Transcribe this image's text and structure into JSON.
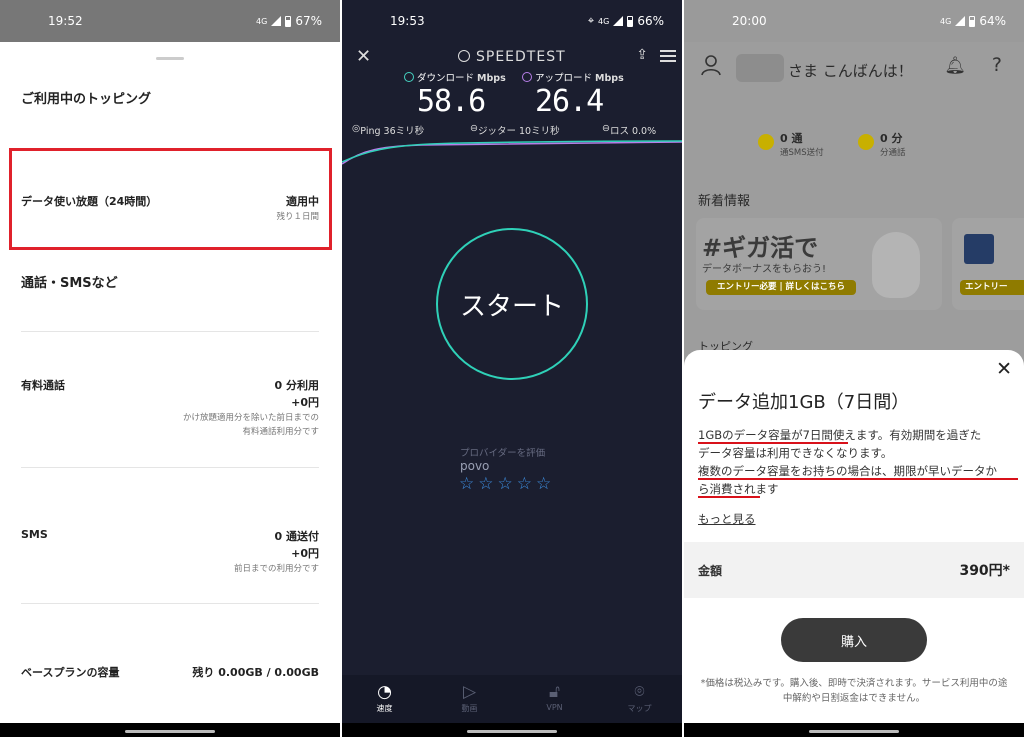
{
  "panel1": {
    "status": {
      "time": "19:52",
      "network": "4G",
      "battery": "67%"
    },
    "current_topping_header": "ご利用中のトッピング",
    "topping": {
      "name": "データ使い放題（24時間）",
      "status": "適用中",
      "remaining": "残り１日間"
    },
    "calls_header": "通話・SMSなど",
    "paid_call": {
      "label": "有料通話",
      "value": "0 分利用",
      "amount": "+0円",
      "note1": "かけ放題適用分を除いた前日までの",
      "note2": "有料通話利用分です"
    },
    "sms": {
      "label": "SMS",
      "value": "0 通送付",
      "amount": "+0円",
      "note": "前日までの利用分です"
    },
    "base_plan": {
      "label": "ベースプランの容量",
      "value": "残り 0.00GB / 0.00GB"
    }
  },
  "panel2": {
    "status": {
      "time": "19:53",
      "network": "4G",
      "battery": "66%"
    },
    "app_title": "SPEEDTEST",
    "download": {
      "label": "ダウンロード",
      "unit": "Mbps",
      "value": "58.6"
    },
    "upload": {
      "label": "アップロード",
      "unit": "Mbps",
      "value": "26.4"
    },
    "ping": "Ping 36ミリ秒",
    "jitter": "ジッター 10ミリ秒",
    "loss": "ロス 0.0%",
    "start_label": "スタート",
    "rate_label": "プロバイダーを評価",
    "provider": "povo",
    "stars": "☆☆☆☆☆",
    "nav": [
      {
        "label": "速度",
        "icon": "gauge-icon"
      },
      {
        "label": "動画",
        "icon": "play-icon"
      },
      {
        "label": "VPN",
        "icon": "lock-icon"
      },
      {
        "label": "マップ",
        "icon": "map-pin-icon"
      }
    ]
  },
  "panel3": {
    "status": {
      "time": "20:00",
      "network": "4G",
      "battery": "64%"
    },
    "greeting": "さま こんばんは！",
    "sms_count": "0 通",
    "sms_label": "通SMS送付",
    "call_count": "0 分",
    "call_label": "分通話",
    "news_header": "新着情報",
    "banner_title": "#ギガ活で",
    "banner_sub": "データボーナスをもらおう!",
    "banner_button": "エントリー必要 | 詳しくはこちら",
    "banner2_button": "エントリー",
    "topping_header": "トッピング",
    "sheet": {
      "title": "データ追加1GB（7日間）",
      "desc_line1": "1GBのデータ容量が7日間使えます。有効期間を過ぎた",
      "desc_line2": "データ容量は利用できなくなります。",
      "desc_line3": "複数のデータ容量をお持ちの場合は、期限が早いデータか",
      "desc_line4": "ら消費されます",
      "more": "もっと見る",
      "price_label": "金額",
      "price_value": "390円*",
      "buy": "購入",
      "note": "*価格は税込みです。購入後、即時で決済されます。サービス利用中の途中解約や日割返金はできません。"
    }
  },
  "colors": {
    "highlight_red": "#e0212b",
    "speedtest_teal": "#2fd1b8",
    "speedtest_purple": "#b67ee8",
    "star_blue": "#3d8fe2"
  }
}
